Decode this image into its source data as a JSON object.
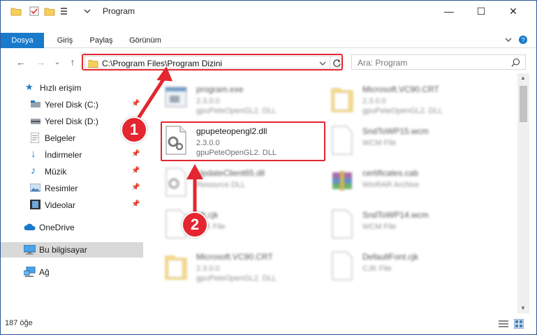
{
  "window": {
    "title": "Program"
  },
  "ribbon": {
    "tabs": [
      "Dosya",
      "Giriş",
      "Paylaş",
      "Görünüm"
    ]
  },
  "nav": {
    "address_path": "C:\\Program Files\\Program Dizini",
    "search_placeholder": "Ara: Program"
  },
  "sidebar": {
    "items": [
      {
        "label": "Hızlı erişim",
        "icon": "star-icon"
      },
      {
        "label": "Yerel Disk (C:)",
        "icon": "drive-icon"
      },
      {
        "label": "Yerel Disk (D:)",
        "icon": "drive-icon"
      },
      {
        "label": "Belgeler",
        "icon": "documents-icon"
      },
      {
        "label": "İndirmeler",
        "icon": "download-icon"
      },
      {
        "label": "Müzik",
        "icon": "music-icon"
      },
      {
        "label": "Resimler",
        "icon": "pictures-icon"
      },
      {
        "label": "Videolar",
        "icon": "videos-icon"
      },
      {
        "label": "OneDrive",
        "icon": "cloud-icon"
      },
      {
        "label": "Bu bilgisayar",
        "icon": "computer-icon"
      },
      {
        "label": "Ağ",
        "icon": "network-icon"
      }
    ]
  },
  "files": [
    {
      "name": "program.exe",
      "sub1": "2.3.0.0",
      "sub2": "gpuPeteOpenGL2. DLL"
    },
    {
      "name": "Microsoft.VC90.CRT",
      "sub1": "2.3.0.0",
      "sub2": "gpuPeteOpenGL2. DLL"
    },
    {
      "name": "gpupeteopengl2.dll",
      "sub1": "2.3.0.0",
      "sub2": "gpuPeteOpenGL2. DLL"
    },
    {
      "name": "SndToWP15.wcm",
      "sub1": "WCM File",
      "sub2": ""
    },
    {
      "name": "UpdateClient65.dll",
      "sub1": "Resource DLL",
      "sub2": ""
    },
    {
      "name": "certificates.cab",
      "sub1": "WinRAR Archive",
      "sub2": ""
    },
    {
      "name": "Mt.cjk",
      "sub1": "CJK File",
      "sub2": ""
    },
    {
      "name": "SndToWP14.wcm",
      "sub1": "WCM File",
      "sub2": ""
    },
    {
      "name": "Microsoft.VC90.CRT",
      "sub1": "2.3.0.0",
      "sub2": "gpuPeteOpenGL2. DLL"
    },
    {
      "name": "DefaultFont.cjk",
      "sub1": "CJK File",
      "sub2": ""
    }
  ],
  "status": {
    "item_count": "187 öğe"
  },
  "callouts": [
    "1",
    "2"
  ],
  "colors": {
    "accent": "#1979ca",
    "highlight": "#e3262f"
  }
}
